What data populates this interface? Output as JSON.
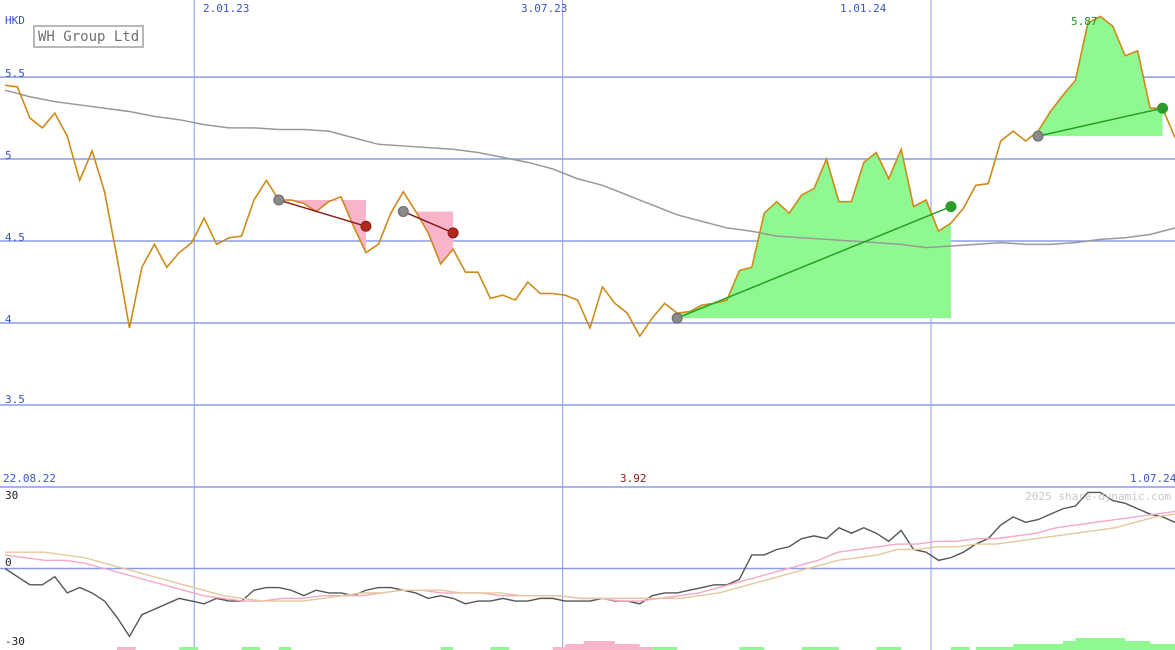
{
  "title": "WH Group Ltd",
  "watermark": "2025 share-dynamic.com",
  "currency": "HKD",
  "start_date": "22.08.22",
  "end_date": "1.07.24",
  "low_label": "3.92",
  "high_label": "5.87",
  "colors": {
    "price": "#cc8a18",
    "ma": "#999999",
    "grid": "#8b9ce6",
    "gain_fill": "#90f890",
    "loss_fill": "#f8b4c8",
    "gain_line": "#22a022",
    "loss_line": "#8b1a1a",
    "osc_main": "#555555",
    "osc_fast": "#f4a8c4",
    "osc_slow": "#e4c89a"
  },
  "chart_data": [
    {
      "type": "line",
      "panel": "price",
      "ylim": [
        3.0,
        5.97
      ],
      "y_ticks": [
        "5.5",
        "5",
        "4.5",
        "4",
        "3.5"
      ],
      "x_ticks": [
        "2.01.23",
        "3.07.23",
        "1.01.24"
      ],
      "series": [
        {
          "key": "price",
          "values": [
            5.45,
            5.44,
            5.25,
            5.19,
            5.28,
            5.14,
            4.87,
            5.05,
            4.8,
            4.4,
            3.97,
            4.34,
            4.48,
            4.34,
            4.43,
            4.49,
            4.64,
            4.48,
            4.52,
            4.53,
            4.75,
            4.87,
            4.75,
            4.75,
            4.73,
            4.68,
            4.74,
            4.77,
            4.59,
            4.43,
            4.48,
            4.67,
            4.8,
            4.68,
            4.55,
            4.36,
            4.45,
            4.31,
            4.31,
            4.15,
            4.17,
            4.14,
            4.25,
            4.18,
            4.18,
            4.17,
            4.14,
            3.97,
            4.22,
            4.12,
            4.06,
            3.92,
            4.03,
            4.12,
            4.06,
            4.07,
            4.11,
            4.12,
            4.14,
            4.32,
            4.34,
            4.67,
            4.74,
            4.67,
            4.78,
            4.82,
            5.0,
            4.74,
            4.74,
            4.98,
            5.04,
            4.88,
            5.06,
            4.71,
            4.75,
            4.56,
            4.61,
            4.7,
            4.84,
            4.85,
            5.11,
            5.17,
            5.11,
            5.17,
            5.29,
            5.39,
            5.48,
            5.83,
            5.87,
            5.81,
            5.63,
            5.66,
            5.31,
            5.31,
            5.13
          ]
        },
        {
          "key": "moving-average",
          "values": [
            5.42,
            5.38,
            5.35,
            5.33,
            5.31,
            5.29,
            5.26,
            5.24,
            5.21,
            5.19,
            5.19,
            5.18,
            5.18,
            5.17,
            5.13,
            5.09,
            5.08,
            5.07,
            5.06,
            5.04,
            5.01,
            4.98,
            4.94,
            4.88,
            4.84,
            4.78,
            4.72,
            4.66,
            4.62,
            4.58,
            4.56,
            4.53,
            4.52,
            4.51,
            4.5,
            4.49,
            4.48,
            4.46,
            4.47,
            4.48,
            4.49,
            4.48,
            4.48,
            4.49,
            4.51,
            4.52,
            4.54,
            4.58,
            4.62,
            4.66,
            4.71,
            4.74,
            4.76
          ],
          "x_step": 2
        }
      ],
      "trades": [
        {
          "entry_index": 22,
          "entry_value": 4.75,
          "exit_index": 29,
          "exit_value": 4.59,
          "result": "loss"
        },
        {
          "entry_index": 32,
          "entry_value": 4.68,
          "exit_index": 36,
          "exit_value": 4.55,
          "result": "loss"
        },
        {
          "entry_index": 54,
          "entry_value": 4.03,
          "exit_index": 76,
          "exit_value": 4.71,
          "result": "gain"
        },
        {
          "entry_index": 83,
          "entry_value": 5.14,
          "exit_index": 93,
          "exit_value": 5.31,
          "result": "gain"
        }
      ]
    },
    {
      "type": "line",
      "panel": "oscillator",
      "ylim": [
        -30,
        30
      ],
      "y_ticks": [
        "30",
        "0",
        "-30"
      ],
      "series": [
        {
          "key": "oscillator",
          "values": [
            0,
            -3,
            -6,
            -6,
            -3,
            -9,
            -7,
            -9,
            -12,
            -18,
            -25,
            -17,
            -15,
            -13,
            -11,
            -12,
            -13,
            -11,
            -12,
            -12,
            -8,
            -7,
            -7,
            -8,
            -10,
            -8,
            -9,
            -9,
            -10,
            -8,
            -7,
            -7,
            -8,
            -9,
            -11,
            -10,
            -11,
            -13,
            -12,
            -12,
            -11,
            -12,
            -12,
            -11,
            -11,
            -12,
            -12,
            -12,
            -11,
            -12,
            -12,
            -13,
            -10,
            -9,
            -9,
            -8,
            -7,
            -6,
            -6,
            -4,
            5,
            5,
            7,
            8,
            11,
            12,
            11,
            15,
            13,
            15,
            13,
            10,
            14,
            7,
            6,
            3,
            4,
            6,
            9,
            11,
            16,
            19,
            17,
            18,
            20,
            22,
            23,
            28,
            28,
            25,
            24,
            22,
            20,
            19,
            17
          ]
        },
        {
          "key": "fast-average",
          "values": [
            5,
            4,
            3,
            3,
            2,
            0,
            -2,
            -4,
            -6,
            -8,
            -10,
            -11,
            -12,
            -12,
            -11,
            -11,
            -10,
            -10,
            -10,
            -9,
            -8,
            -8,
            -9,
            -9,
            -9,
            -10,
            -10,
            -10,
            -10,
            -11,
            -11,
            -12,
            -12,
            -11,
            -10,
            -9,
            -7,
            -5,
            -3,
            -1,
            1,
            3,
            6,
            7,
            8,
            9,
            9,
            10,
            10,
            11,
            11,
            12,
            13,
            15,
            16,
            17,
            18,
            19,
            20,
            21
          ]
        },
        {
          "key": "slow-average",
          "values": [
            6,
            6,
            6,
            5,
            4,
            2,
            0,
            -2,
            -4,
            -6,
            -8,
            -10,
            -11,
            -12,
            -12,
            -12,
            -11,
            -10,
            -9,
            -9,
            -8,
            -8,
            -8,
            -9,
            -9,
            -9,
            -10,
            -10,
            -10,
            -11,
            -11,
            -11,
            -11,
            -11,
            -11,
            -10,
            -9,
            -7,
            -5,
            -3,
            -1,
            1,
            3,
            4,
            5,
            7,
            7,
            8,
            8,
            9,
            9,
            10,
            11,
            12,
            13,
            14,
            15,
            17,
            19,
            20
          ]
        }
      ],
      "volume_bars": [
        {
          "start": 9,
          "end": 10.5,
          "kind": "down",
          "value": 1
        },
        {
          "start": 14,
          "end": 15.5,
          "kind": "up",
          "value": 1
        },
        {
          "start": 19,
          "end": 20.5,
          "kind": "up",
          "value": 1
        },
        {
          "start": 22,
          "end": 23,
          "kind": "up",
          "value": 1
        },
        {
          "start": 35,
          "end": 36,
          "kind": "up",
          "value": 1
        },
        {
          "start": 39,
          "end": 40.5,
          "kind": "up",
          "value": 1
        },
        {
          "start": 44,
          "end": 52,
          "kind": "down",
          "value": 1
        },
        {
          "start": 45,
          "end": 51,
          "kind": "down",
          "value": 2
        },
        {
          "start": 46.5,
          "end": 49,
          "kind": "down",
          "value": 3
        },
        {
          "start": 52,
          "end": 54,
          "kind": "up",
          "value": 1
        },
        {
          "start": 59,
          "end": 61,
          "kind": "up",
          "value": 1
        },
        {
          "start": 64,
          "end": 67,
          "kind": "up",
          "value": 1
        },
        {
          "start": 70,
          "end": 72,
          "kind": "up",
          "value": 1
        },
        {
          "start": 76,
          "end": 77.5,
          "kind": "up",
          "value": 1
        },
        {
          "start": 78,
          "end": 80,
          "kind": "up",
          "value": 1
        },
        {
          "start": 79.5,
          "end": 94,
          "kind": "up",
          "value": 1
        },
        {
          "start": 81,
          "end": 94,
          "kind": "up",
          "value": 2
        },
        {
          "start": 85,
          "end": 92,
          "kind": "up",
          "value": 3
        },
        {
          "start": 86,
          "end": 90,
          "kind": "up",
          "value": 4
        }
      ]
    }
  ]
}
